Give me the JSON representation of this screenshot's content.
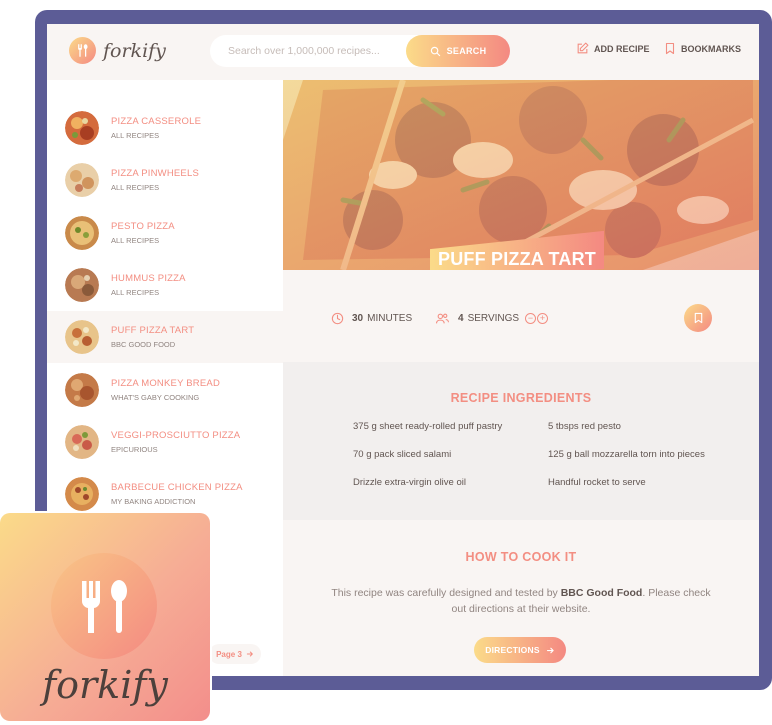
{
  "app": {
    "logo_text": "forkify"
  },
  "header": {
    "search_placeholder": "Search over 1,000,000 recipes...",
    "search_button": "SEARCH",
    "add_recipe": "ADD RECIPE",
    "bookmarks": "BOOKMARKS"
  },
  "results": [
    {
      "title": "PIZZA CASSEROLE",
      "publisher": "ALL RECIPES",
      "active": false
    },
    {
      "title": "PIZZA PINWHEELS",
      "publisher": "ALL RECIPES",
      "active": false
    },
    {
      "title": "PESTO PIZZA",
      "publisher": "ALL RECIPES",
      "active": false
    },
    {
      "title": "HUMMUS PIZZA",
      "publisher": "ALL RECIPES",
      "active": false
    },
    {
      "title": "PUFF PIZZA TART",
      "publisher": "BBC GOOD FOOD",
      "active": true
    },
    {
      "title": "PIZZA MONKEY BREAD",
      "publisher": "WHAT'S GABY COOKING",
      "active": false
    },
    {
      "title": "VEGGI-PROSCIUTTO PIZZA",
      "publisher": "EPICURIOUS",
      "active": false
    },
    {
      "title": "BARBECUE CHICKEN PIZZA",
      "publisher": "MY BAKING ADDICTION",
      "active": false
    }
  ],
  "pagination": {
    "next_label": "Page 3"
  },
  "recipe": {
    "title": "PUFF PIZZA TART",
    "minutes_value": "30",
    "minutes_label": "MINUTES",
    "servings_value": "4",
    "servings_label": "SERVINGS",
    "ingredients_title": "RECIPE INGREDIENTS",
    "ingredients": [
      "375 g sheet ready-rolled puff pastry",
      "5 tbsps red pesto",
      "70 g pack sliced salami",
      "125 g ball mozzarella torn into pieces",
      "Drizzle extra-virgin olive oil",
      "Handful rocket to serve"
    ],
    "cook_title": "HOW TO COOK IT",
    "cook_text_before": "This recipe was carefully designed and tested by ",
    "cook_publisher": "BBC Good Food",
    "cook_text_after": ". Please check out directions at their website.",
    "directions_button": "DIRECTIONS"
  },
  "badge": {
    "logo_text": "forkify"
  },
  "colors": {
    "frame": "#5c5c96",
    "accent_start": "#fbdb89",
    "accent_end": "#f48982",
    "accent_text": "#f38e82",
    "text": "#615551"
  }
}
